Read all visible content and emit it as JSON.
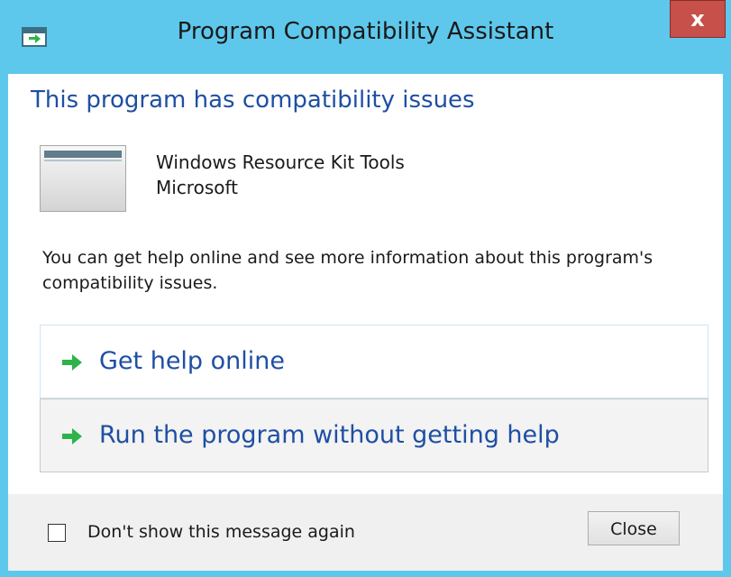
{
  "window": {
    "title": "Program Compatibility Assistant",
    "close_glyph": "x",
    "app_icon": "program-compatibility-icon"
  },
  "content": {
    "heading": "This program has compatibility issues",
    "program": {
      "icon": "program-window-icon",
      "name": "Windows Resource Kit Tools",
      "publisher": "Microsoft"
    },
    "info": "You can get help online and see more information about this program's compatibility issues.",
    "commands": [
      {
        "icon": "green-arrow-icon",
        "label": "Get help online"
      },
      {
        "icon": "green-arrow-icon",
        "label": "Run the program without getting help"
      }
    ]
  },
  "footer": {
    "checkbox_label": "Don't show this message again",
    "checkbox_checked": false,
    "close_button": "Close"
  },
  "colors": {
    "frame": "#5ec8ec",
    "close_x_bg": "#c7504a",
    "heading": "#1e4fa3",
    "link": "#1e4fa3",
    "arrow": "#2db34a",
    "footer_bg": "#f0f0f0"
  }
}
